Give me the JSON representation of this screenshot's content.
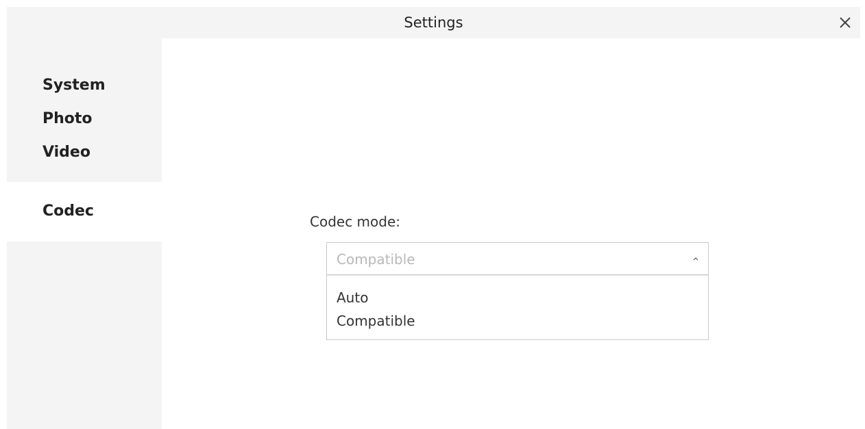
{
  "window": {
    "title": "Settings",
    "close_icon": "close-icon"
  },
  "sidebar": {
    "items": [
      {
        "label": "System"
      },
      {
        "label": "Photo"
      },
      {
        "label": "Video"
      },
      {
        "label": "Codec",
        "selected": true
      }
    ]
  },
  "codec": {
    "label": "Codec mode:",
    "select": {
      "value": "Compatible",
      "expanded": true,
      "arrow_icon": "chevron-up-icon"
    },
    "options": [
      {
        "label": "Auto"
      },
      {
        "label": "Compatible"
      }
    ]
  },
  "colors": {
    "panel_bg": "#f4f4f4",
    "border": "#c8c8c8",
    "text": "#222222",
    "placeholder_text": "#b8b8b8"
  }
}
